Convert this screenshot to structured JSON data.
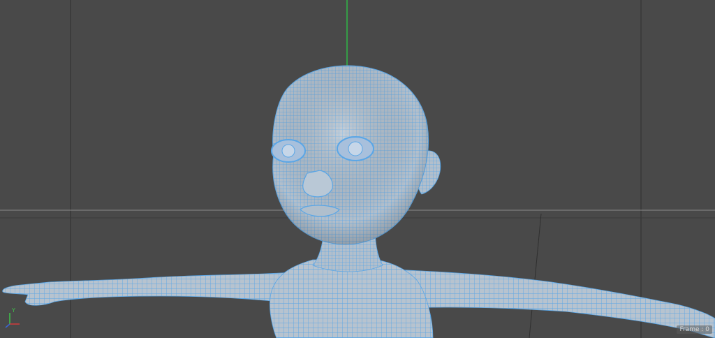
{
  "viewport": {
    "frame_label": "Frame",
    "frame_value": "0",
    "gizmo": {
      "y_axis_label": "Y",
      "x_axis_color": "#d23a3a",
      "y_axis_color": "#3fc24a",
      "z_axis_color": "#3a66d6"
    },
    "colors": {
      "background": "#494949",
      "grid_line": "#2f2f2f",
      "horizon_line": "#8a8a8a",
      "world_y_axis": "#2fb845",
      "model_surface": "#a9b9c9",
      "wireframe": "#5aa6e6"
    }
  }
}
